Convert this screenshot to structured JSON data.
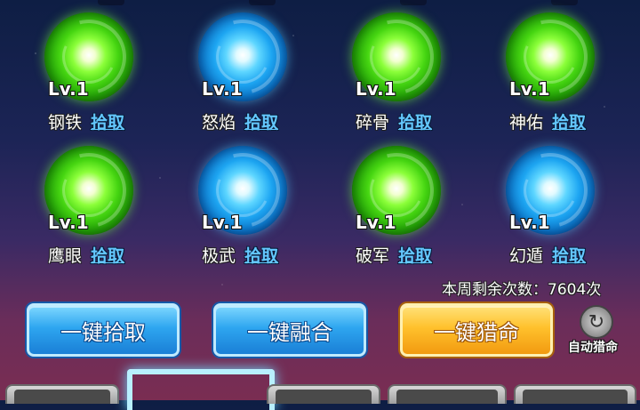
{
  "slots": [
    {
      "level": "Lv.1",
      "name": "钢铁",
      "action": "拾取",
      "color": "green"
    },
    {
      "level": "Lv.1",
      "name": "怒焰",
      "action": "拾取",
      "color": "blue"
    },
    {
      "level": "Lv.1",
      "name": "碎骨",
      "action": "拾取",
      "color": "green"
    },
    {
      "level": "Lv.1",
      "name": "神佑",
      "action": "拾取",
      "color": "green"
    },
    {
      "level": "Lv.1",
      "name": "鹰眼",
      "action": "拾取",
      "color": "green"
    },
    {
      "level": "Lv.1",
      "name": "极武",
      "action": "拾取",
      "color": "blue"
    },
    {
      "level": "Lv.1",
      "name": "破军",
      "action": "拾取",
      "color": "green"
    },
    {
      "level": "Lv.1",
      "name": "幻遁",
      "action": "拾取",
      "color": "blue"
    }
  ],
  "remaining_text": "本周剩余次数：7604次",
  "buttons": {
    "pickup_all": "一键拾取",
    "merge_all": "一键融合",
    "hunt_all": "一键猎命",
    "auto_hunt": "自动猎命"
  },
  "colors": {
    "green_orb": "#46d612",
    "blue_orb": "#1ea6f2",
    "pick_link": "#64c8ff",
    "gold_button": "#ffc12c",
    "blue_button": "#2ea6f0"
  }
}
